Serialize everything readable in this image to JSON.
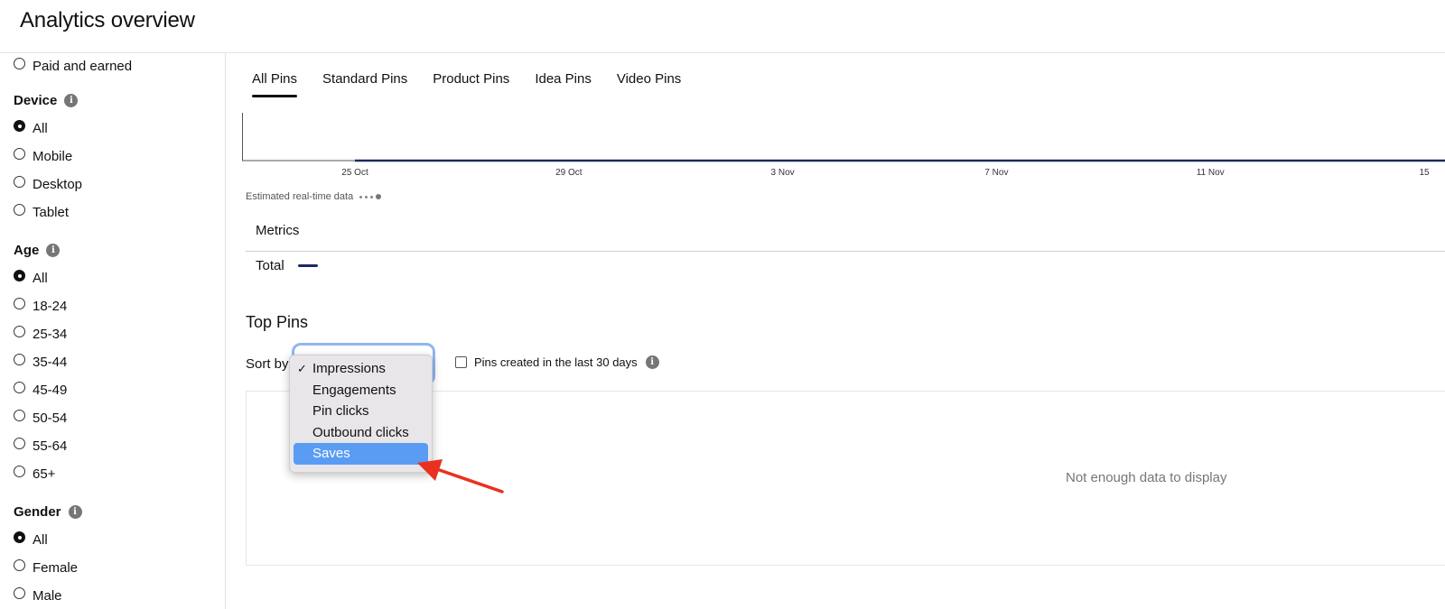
{
  "header": {
    "title": "Analytics overview"
  },
  "sidebar": {
    "top_item": {
      "label": "Paid and earned",
      "checked": false
    },
    "groups": [
      {
        "title": "Device",
        "options": [
          {
            "label": "All",
            "checked": true
          },
          {
            "label": "Mobile",
            "checked": false
          },
          {
            "label": "Desktop",
            "checked": false
          },
          {
            "label": "Tablet",
            "checked": false
          }
        ]
      },
      {
        "title": "Age",
        "options": [
          {
            "label": "All",
            "checked": true
          },
          {
            "label": "18-24",
            "checked": false
          },
          {
            "label": "25-34",
            "checked": false
          },
          {
            "label": "35-44",
            "checked": false
          },
          {
            "label": "45-49",
            "checked": false
          },
          {
            "label": "50-54",
            "checked": false
          },
          {
            "label": "55-64",
            "checked": false
          },
          {
            "label": "65+",
            "checked": false
          }
        ]
      },
      {
        "title": "Gender",
        "options": [
          {
            "label": "All",
            "checked": true
          },
          {
            "label": "Female",
            "checked": false
          },
          {
            "label": "Male",
            "checked": false
          }
        ]
      }
    ]
  },
  "tabs": [
    {
      "label": "All Pins",
      "active": true
    },
    {
      "label": "Standard Pins",
      "active": false
    },
    {
      "label": "Product Pins",
      "active": false
    },
    {
      "label": "Idea Pins",
      "active": false
    },
    {
      "label": "Video Pins",
      "active": false
    }
  ],
  "chart": {
    "x_ticks": [
      "25 Oct",
      "29 Oct",
      "3 Nov",
      "7 Nov",
      "11 Nov",
      "15"
    ],
    "line_color": "#1b2a5e"
  },
  "realtime_label": "Estimated real-time data",
  "metrics": {
    "title": "Metrics",
    "row_label": "Total",
    "legend_color": "#1b2a5e"
  },
  "top_pins": {
    "title": "Top Pins",
    "sort_label": "Sort by",
    "created_filter_label": "Pins created in the last 30 days",
    "empty_message": "Not enough data to display"
  },
  "sort_dropdown": {
    "options": [
      {
        "label": "Impressions",
        "selected": true,
        "highlighted": false
      },
      {
        "label": "Engagements",
        "selected": false,
        "highlighted": false
      },
      {
        "label": "Pin clicks",
        "selected": false,
        "highlighted": false
      },
      {
        "label": "Outbound clicks",
        "selected": false,
        "highlighted": false
      },
      {
        "label": "Saves",
        "selected": false,
        "highlighted": true
      }
    ],
    "check_glyph": "✓",
    "highlight_color": "#5a9cf4"
  },
  "annotation": {
    "arrow_color": "#e8321f"
  }
}
